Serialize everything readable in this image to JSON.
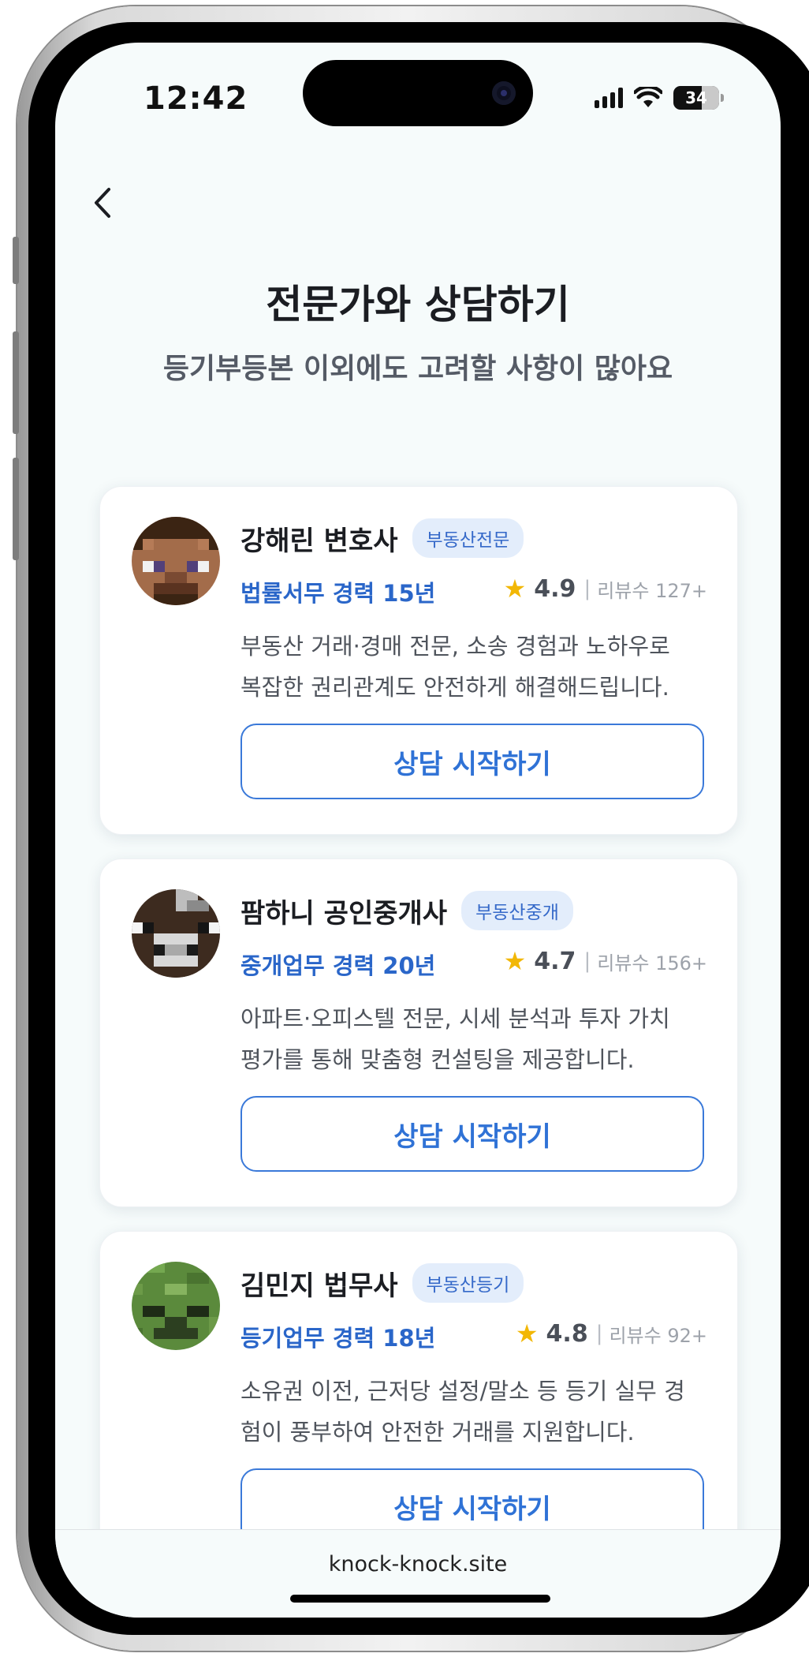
{
  "status_bar": {
    "time": "12:42",
    "battery_level": "34"
  },
  "header": {
    "title": "전문가와 상담하기",
    "subtitle": "등기부등본 이외에도 고려할 사항이 많아요"
  },
  "experts": [
    {
      "name": "강해린 변호사",
      "tag": "부동산전문",
      "career": "법률서무 경력 15년",
      "rating": "4.9",
      "reviews": "리뷰수 127+",
      "desc_line1": "부동산 거래·경매 전문, 소송 경험과 노하우로",
      "desc_line2": "복잡한 권리관계도 안전하게 해결해드립니다.",
      "cta": "상담 시작하기"
    },
    {
      "name": "팜하니 공인중개사",
      "tag": "부동산중개",
      "career": "중개업무 경력 20년",
      "rating": "4.7",
      "reviews": "리뷰수 156+",
      "desc_line1": "아파트·오피스텔 전문, 시세 분석과 투자 가치",
      "desc_line2": "평가를 통해 맞춤형 컨설팅을 제공합니다.",
      "cta": "상담 시작하기"
    },
    {
      "name": "김민지 법무사",
      "tag": "부동산등기",
      "career": "등기업무 경력 18년",
      "rating": "4.8",
      "reviews": "리뷰수 92+",
      "desc_line1": "소유권 이전, 근저당 설정/말소 등 등기 실무 경",
      "desc_line2": "험이 풍부하여 안전한 거래를 지원합니다.",
      "cta": "상담 시작하기"
    }
  ],
  "footer": {
    "url": "knock-knock.site"
  },
  "colors": {
    "accent": "#2f72d6",
    "tag_bg": "#e3edfb",
    "star": "#f2b705",
    "background": "#f6fbfb"
  },
  "icons": {
    "back": "chevron-left-icon",
    "signal": "cellular-signal-icon",
    "wifi": "wifi-icon",
    "battery": "battery-icon",
    "rating": "star-icon"
  }
}
